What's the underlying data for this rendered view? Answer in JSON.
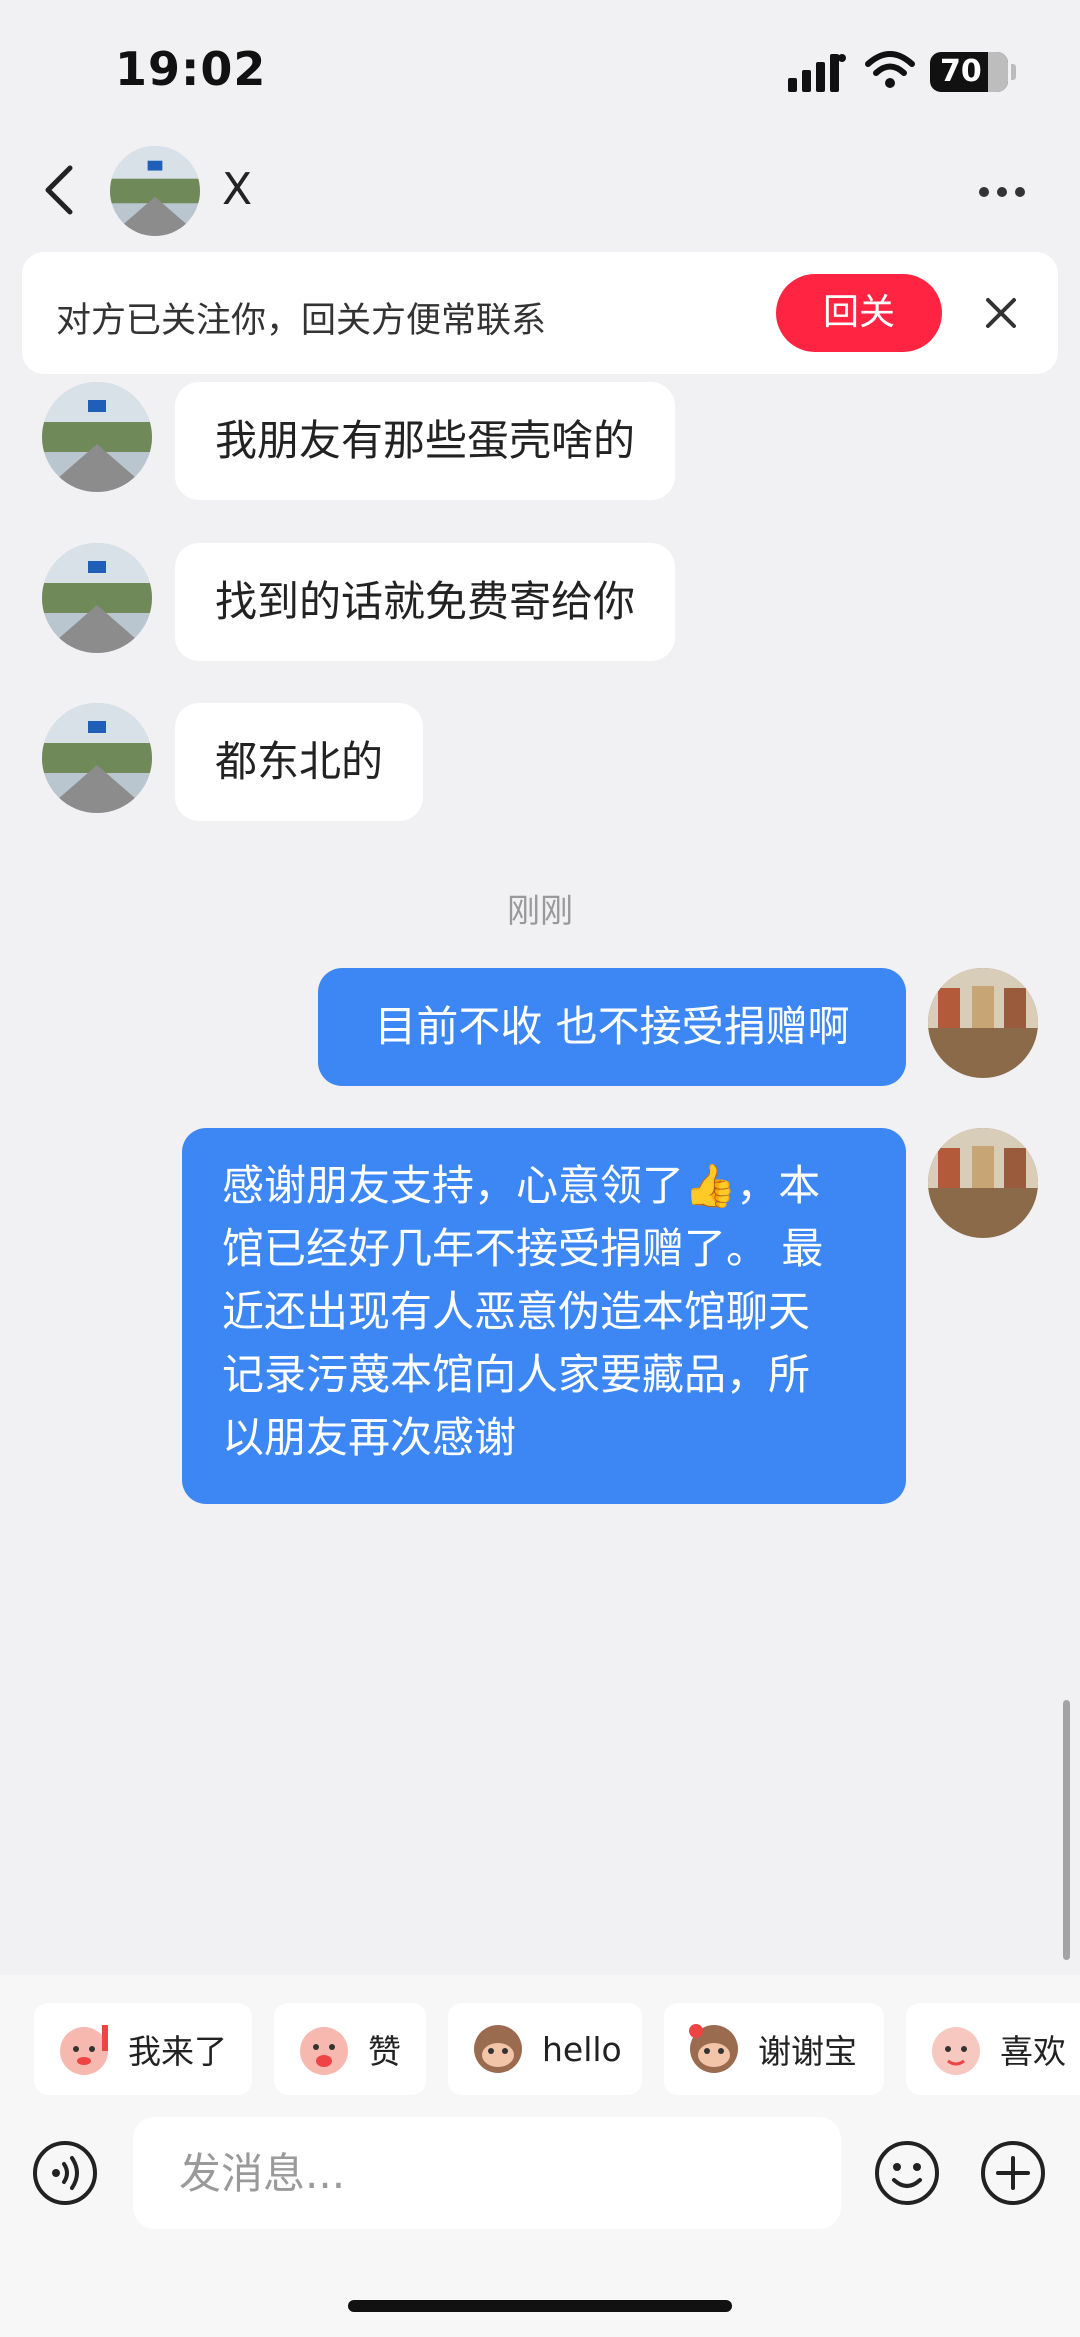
{
  "status_bar": {
    "time": "19:02",
    "battery": "70"
  },
  "header": {
    "name": "X",
    "avatar_icon": "user-avatar"
  },
  "banner": {
    "text": "对方已关注你，回关方便常联系",
    "follow_label": "回关"
  },
  "messages_in": [
    {
      "text": "我朋友有那些蛋壳啥的"
    },
    {
      "text": "找到的话就免费寄给你"
    },
    {
      "text": "都东北的"
    }
  ],
  "time_separator": "刚刚",
  "messages_out": [
    {
      "text": "目前不收 也不接受捐赠啊"
    },
    {
      "lines": [
        "感谢朋友支持，心意领了👍，本",
        "馆已经好几年不接受捐赠了。 最",
        "近还出现有人恶意伪造本馆聊天",
        "记录污蔑本馆向人家要藏品，所",
        "以朋友再次感谢"
      ]
    }
  ],
  "quick_replies": [
    {
      "label": "我来了"
    },
    {
      "label": "赞"
    },
    {
      "label": "hello"
    },
    {
      "label": "谢谢宝"
    },
    {
      "label": "喜欢"
    }
  ],
  "composer": {
    "placeholder": "发消息..."
  },
  "colors": {
    "accent_blue": "#3d87f5",
    "follow_red": "#ff2442"
  }
}
